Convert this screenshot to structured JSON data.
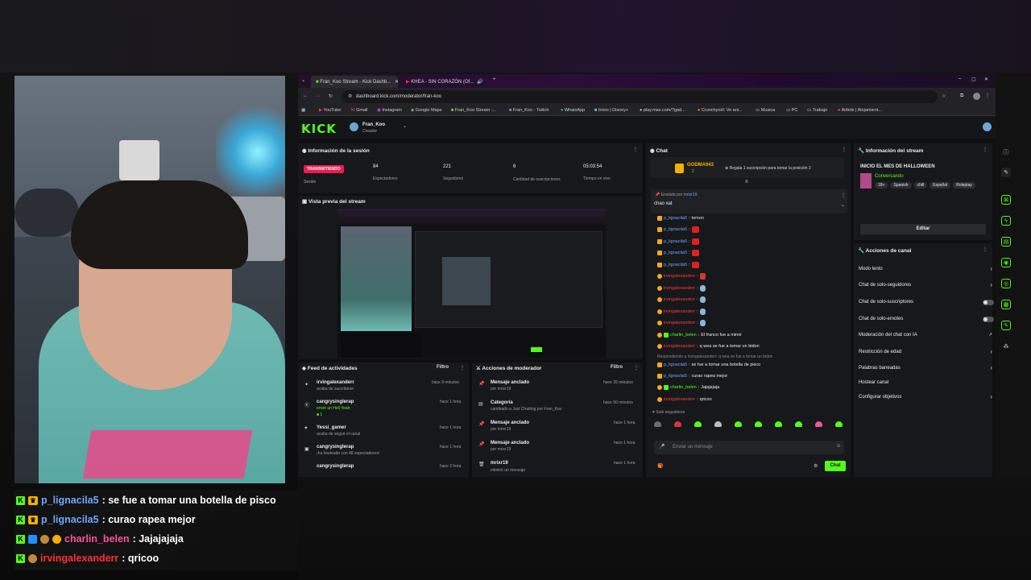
{
  "browser": {
    "tabs": [
      {
        "label": "Fran_Koo Stream - Kick Dashb..."
      },
      {
        "label": "KHEA - SIN CORAZÓN (Of..."
      }
    ],
    "url": "dashboard.kick.com/moderator/fran-koo",
    "bookmarks": [
      "YouTube",
      "Gmail",
      "Instagram",
      "Google Maps",
      "Fran_Koo Stream -...",
      "Fran_Koo - Twitch",
      "WhatsApp",
      "Inicio | Disney+",
      "play.max.com/?gad...",
      "Crunchyroll: Ve ani...",
      "Musica",
      "PC",
      "Trabajo",
      "Airbnb | Alojamient..."
    ]
  },
  "kick": {
    "logo": "KICK",
    "channel_name": "Fran_Koo",
    "channel_role": "Creador"
  },
  "session": {
    "title": "Información de la sesión",
    "status_badge": "TRANSMITIENDO",
    "status_label": "Sesión",
    "stats": [
      {
        "value": "84",
        "label": "Espectadores"
      },
      {
        "value": "221",
        "label": "Seguidores"
      },
      {
        "value": "6",
        "label": "Cantidad de suscripciones"
      },
      {
        "value": "05:03:54",
        "label": "Tiempo en vivo"
      }
    ]
  },
  "preview": {
    "title": "Vista previa del stream"
  },
  "activity": {
    "title": "Feed de actividades",
    "filter": "Filtro",
    "items": [
      {
        "user": "irvingalexanderr",
        "desc": "acaba de suscribirse",
        "time": "hace 9 minutos"
      },
      {
        "user": "cangrysinglerap",
        "desc": "envió un Hell Yeah",
        "extra": "1",
        "time": "hace 1 hora"
      },
      {
        "user": "Yessi_gamer",
        "desc": "acaba de seguir el canal",
        "time": "hace 1 hora"
      },
      {
        "user": "cangrysinglerap",
        "desc": "¡ha hosteado con 48 espectadores!",
        "time": "hace 1 hora"
      },
      {
        "user": "cangrysinglerap",
        "desc": "",
        "time": "hace 2 hora"
      }
    ]
  },
  "modactions": {
    "title": "Acciones de moderador",
    "filter": "Filtro",
    "items": [
      {
        "title": "Mensaje anclado",
        "desc": "por mrixr19",
        "time": "hace 39 minutos"
      },
      {
        "title": "Categoría",
        "desc": "cambiado a Just Chatting por Fran_Koo",
        "time": "hace 50 minutos"
      },
      {
        "title": "Mensaje anclado",
        "desc": "por mrixr19",
        "time": "hace 1 hora"
      },
      {
        "title": "Mensaje anclado",
        "desc": "por mrixr19",
        "time": "hace 1 hora"
      },
      {
        "title": "mrixr19",
        "desc": "eliminó un mensaje",
        "time": "hace 1 hora"
      }
    ]
  },
  "chat": {
    "title": "Chat",
    "top_gifter": "GODMA943",
    "top_gifter_count": "2",
    "gift_prompt": "Regala 1 suscripción para tomar la posición 2",
    "pinned_by_label": "Enviado por",
    "pinned_by": "mrixr19",
    "pinned_text": "chao xat",
    "messages": [
      {
        "user": "p_lignacila5",
        "color": "blue",
        "text": "temon"
      },
      {
        "user": "p_lignacila5",
        "color": "blue",
        "text": ""
      },
      {
        "user": "p_lignacila5",
        "color": "blue",
        "text": ""
      },
      {
        "user": "p_lignacila5",
        "color": "blue",
        "text": ""
      },
      {
        "user": "p_lignacila5",
        "color": "blue",
        "text": ""
      },
      {
        "user": "irvingalexanderr",
        "color": "red",
        "text": ""
      },
      {
        "user": "irvingalexanderr",
        "color": "red",
        "text": ""
      },
      {
        "user": "irvingalexanderr",
        "color": "red",
        "text": ""
      },
      {
        "user": "irvingalexanderr",
        "color": "red",
        "text": ""
      },
      {
        "user": "irvingalexanderr",
        "color": "red",
        "text": ""
      },
      {
        "user": "charlin_belen",
        "color": "green",
        "text": "El franco fue a mimir"
      },
      {
        "user": "irvingalexanderr",
        "color": "red",
        "text": "q wea se fue a tomar un bidon"
      },
      {
        "user": "",
        "color": "reply",
        "text": "Respondiendo a irvingalexanderr: q wea se fue a tomar un bidon"
      },
      {
        "user": "p_lignacila5",
        "color": "blue",
        "text": "se fue a tomar una botella de pisco"
      },
      {
        "user": "p_lignacila5",
        "color": "blue",
        "text": "curao rapea mejor"
      },
      {
        "user": "charlin_belen",
        "color": "green",
        "text": "Jajajajaja"
      },
      {
        "user": "irvingalexanderr",
        "color": "red",
        "text": "qricoo"
      }
    ],
    "mode_label": "Solo seguidores",
    "input_placeholder": "Enviar un mensaje",
    "send_label": "Chat"
  },
  "stream_info": {
    "title": "Información del stream",
    "stream_title": "INICIO EL MES DE HALLOWEEN",
    "category": "Conversando",
    "tags": [
      "18+",
      "Spanish",
      "chill",
      "Español",
      "Roleplay"
    ],
    "edit_label": "Editar"
  },
  "channel_actions": {
    "title": "Acciones de canal",
    "items": [
      {
        "label": "Modo lento",
        "control": "chevron"
      },
      {
        "label": "Chat de solo-seguidores",
        "control": "chevron"
      },
      {
        "label": "Chat de solo-suscriptores",
        "control": "toggle"
      },
      {
        "label": "Chat de solo-emotes",
        "control": "toggle"
      },
      {
        "label": "Moderación del chat con IA",
        "control": "external"
      },
      {
        "label": "Restricción de edad",
        "control": "chevron"
      },
      {
        "label": "Palabras baneadas",
        "control": "chevron"
      },
      {
        "label": "Hostear canal",
        "control": "none"
      },
      {
        "label": "Configurar objetivos",
        "control": "chevron"
      }
    ]
  },
  "overlay_chat": [
    {
      "user": "p_lignacila5",
      "color": "#6ea8ff",
      "text": ": se fue a tomar una botella de pisco"
    },
    {
      "user": "p_lignacila5",
      "color": "#6ea8ff",
      "text": ": curao rapea mejor"
    },
    {
      "user": "charlin_belen",
      "color": "#ff4fa0",
      "text": ": Jajajajaja"
    },
    {
      "user": "irvingalexanderr",
      "color": "#ff3030",
      "text": ": qricoo"
    }
  ],
  "colors": {
    "accent": "#53fc18",
    "live": "#e91e4f",
    "blue_name": "#6ea8ff",
    "red_name": "#ff3b3b"
  }
}
